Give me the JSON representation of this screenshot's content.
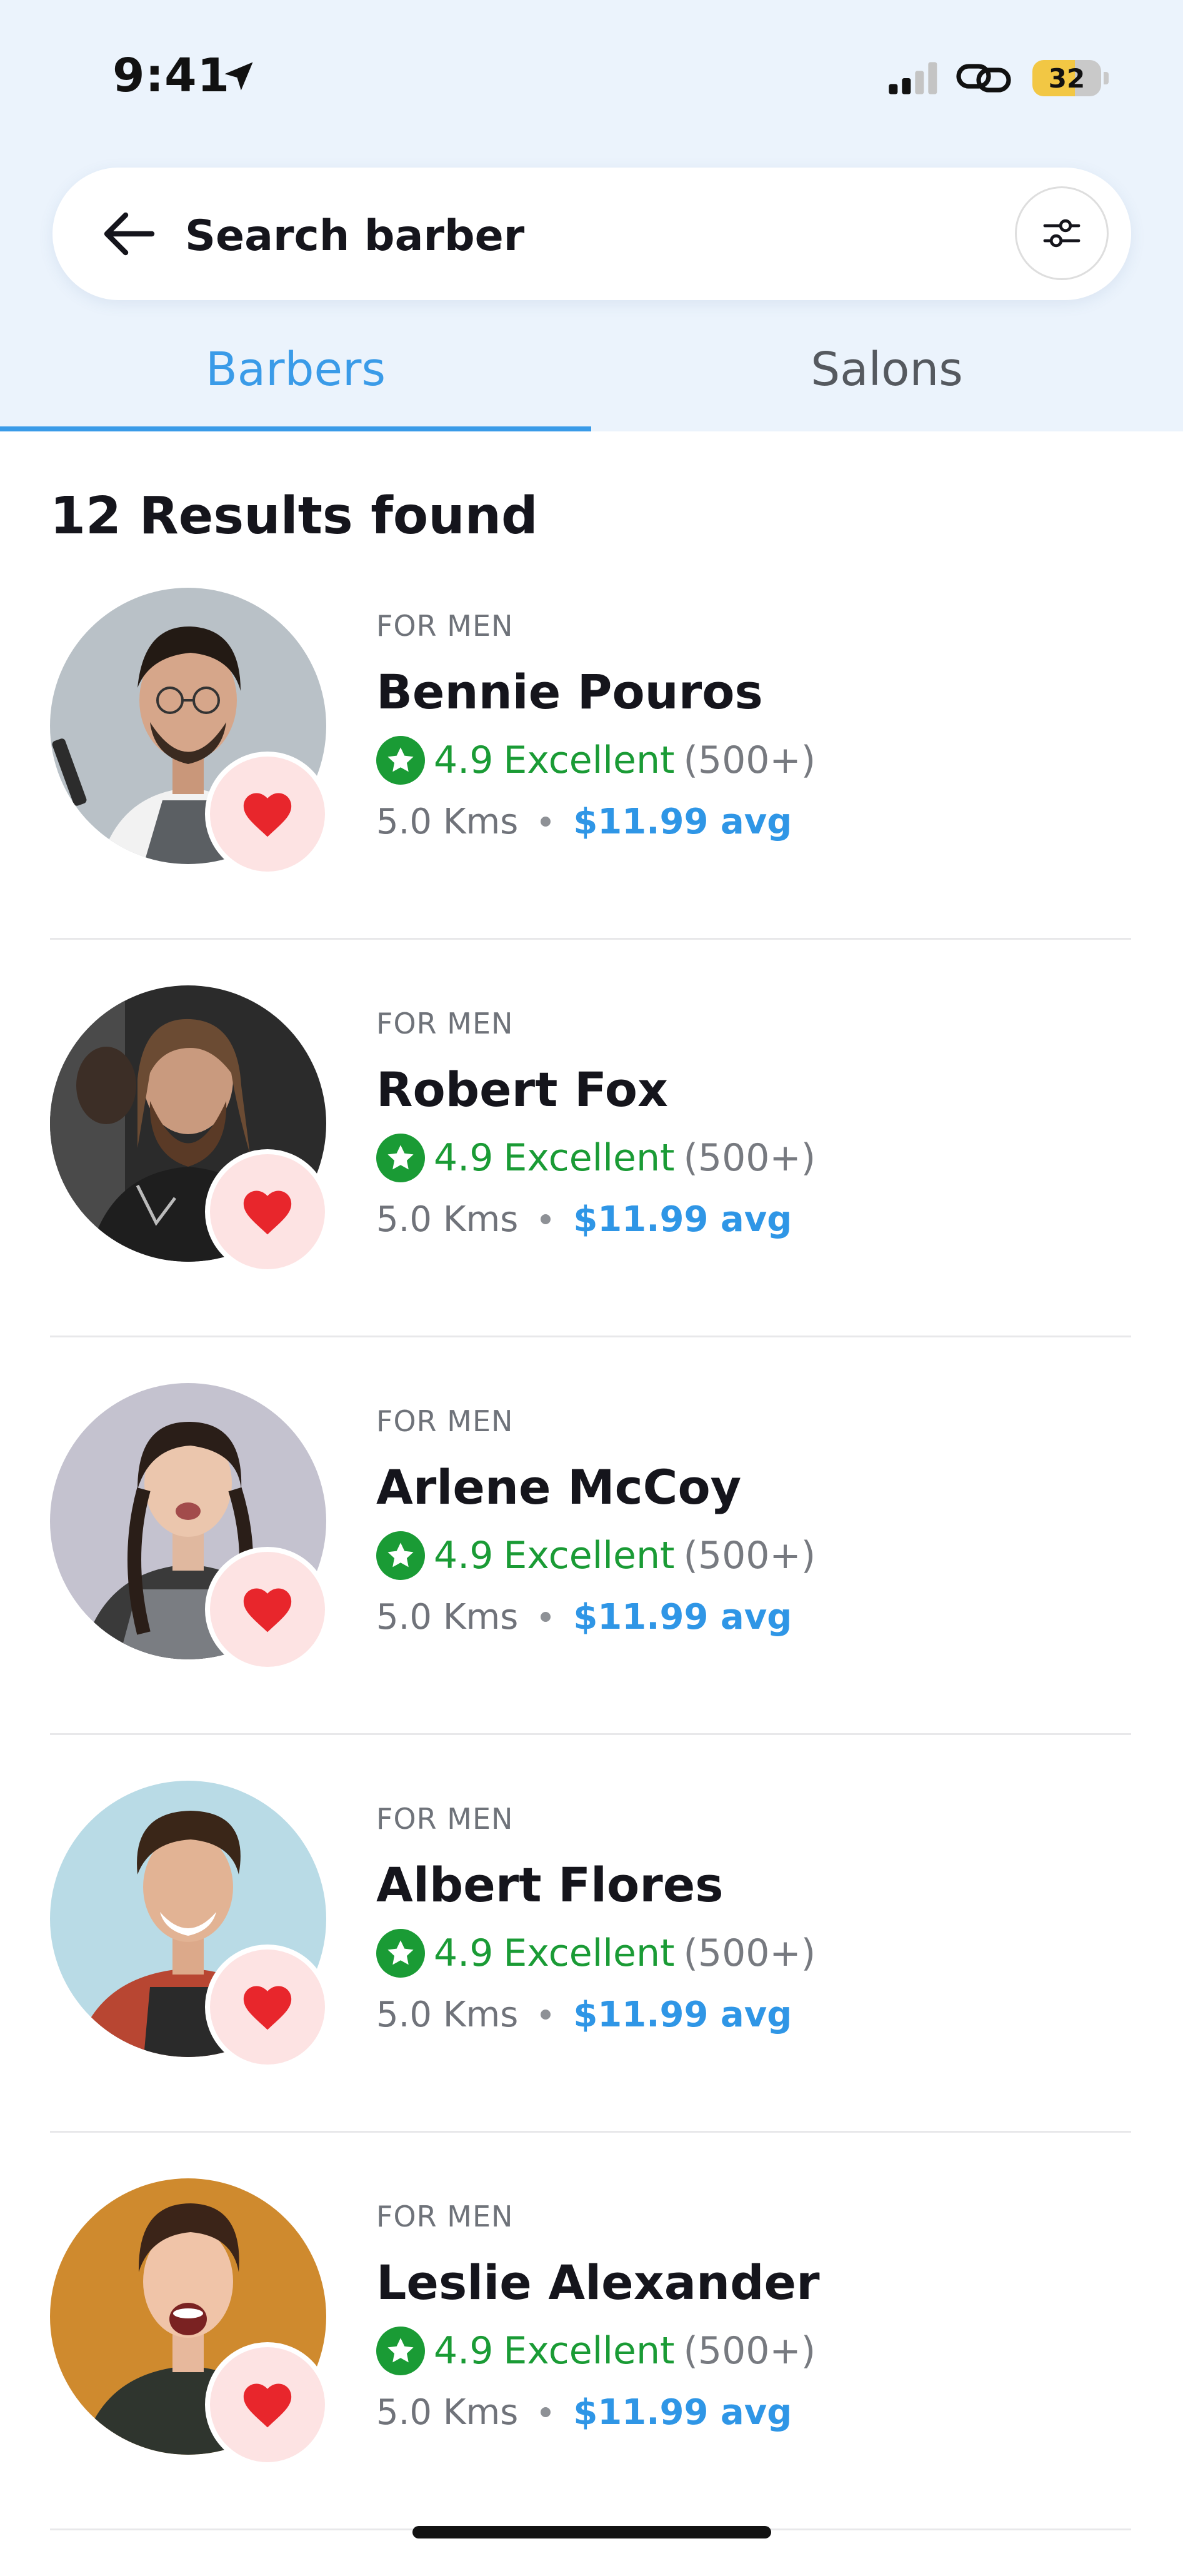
{
  "status_bar": {
    "time": "9:41",
    "battery": "32",
    "icons": [
      "location-arrow-icon",
      "cellular-signal-icon",
      "link-icon",
      "battery-icon"
    ]
  },
  "search": {
    "text": "Search barber",
    "back_icon": "arrow-left-icon",
    "filter_icon": "sliders-icon"
  },
  "tabs": [
    {
      "label": "Barbers",
      "active": true
    },
    {
      "label": "Salons",
      "active": false
    }
  ],
  "results": {
    "title": "12 Results found",
    "items": [
      {
        "category": "FOR MEN",
        "name": "Bennie Pouros",
        "rating": "4.9",
        "rating_label": "Excellent",
        "reviews": "(500+)",
        "distance": "5.0 Kms",
        "price": "$11.99 avg"
      },
      {
        "category": "FOR MEN",
        "name": "Robert Fox",
        "rating": "4.9",
        "rating_label": "Excellent",
        "reviews": "(500+)",
        "distance": "5.0 Kms",
        "price": "$11.99 avg"
      },
      {
        "category": "FOR MEN",
        "name": "Arlene McCoy",
        "rating": "4.9",
        "rating_label": "Excellent",
        "reviews": "(500+)",
        "distance": "5.0 Kms",
        "price": "$11.99 avg"
      },
      {
        "category": "FOR MEN",
        "name": "Albert Flores",
        "rating": "4.9",
        "rating_label": "Excellent",
        "reviews": "(500+)",
        "distance": "5.0 Kms",
        "price": "$11.99 avg"
      },
      {
        "category": "FOR MEN",
        "name": "Leslie Alexander",
        "rating": "4.9",
        "rating_label": "Excellent",
        "reviews": "(500+)",
        "distance": "5.0 Kms",
        "price": "$11.99 avg"
      }
    ]
  },
  "colors": {
    "accent": "#3a9be8",
    "rating_green": "#1a9b35",
    "heart_red": "#e8262c",
    "header_bg": "#ebf3fc"
  }
}
